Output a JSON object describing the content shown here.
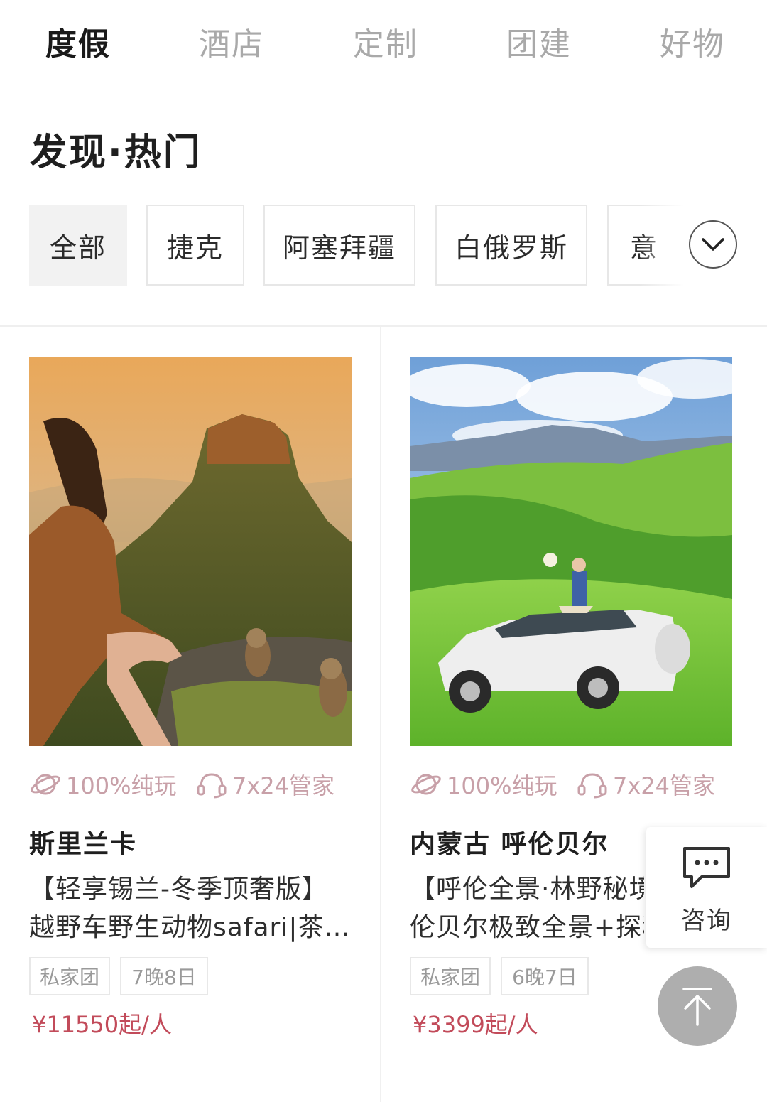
{
  "top_tabs": [
    {
      "label": "度假",
      "active": true
    },
    {
      "label": "酒店",
      "active": false
    },
    {
      "label": "定制",
      "active": false
    },
    {
      "label": "团建",
      "active": false
    },
    {
      "label": "好物",
      "active": false
    }
  ],
  "section": {
    "title": "发现·热门"
  },
  "filters": [
    {
      "label": "全部",
      "active": true
    },
    {
      "label": "捷克",
      "active": false
    },
    {
      "label": "阿塞拜疆",
      "active": false
    },
    {
      "label": "白俄罗斯",
      "active": false
    },
    {
      "label": "意",
      "active": false
    }
  ],
  "expand_icon": "chevron-down-icon",
  "cards": [
    {
      "photo_icon": "photo-sri-lanka-sigiriya",
      "features": [
        {
          "icon": "planet-icon",
          "label": "100%纯玩"
        },
        {
          "icon": "headset-icon",
          "label": "7x24管家"
        }
      ],
      "destination": "斯里兰卡",
      "desc_line1": "【轻享锡兰-冬季顶奢版】",
      "desc_line2": "越野车野生动物safari|茶…",
      "tags": [
        "私家团",
        "7晚8日"
      ],
      "price": "¥11550起/人"
    },
    {
      "photo_icon": "photo-inner-mongolia-grassland",
      "features": [
        {
          "icon": "planet-icon",
          "label": "100%纯玩"
        },
        {
          "icon": "headset-icon",
          "label": "7x24管家"
        }
      ],
      "destination": "内蒙古 呼伦贝尔",
      "desc_line1": "【呼伦全景·林野秘境",
      "desc_line2": "伦贝尔极致全景+探秘",
      "tags": [
        "私家团",
        "6晚7日"
      ],
      "price": "¥3399起/人"
    }
  ],
  "consult": {
    "label": "咨询",
    "icon": "chat-bubble-icon"
  },
  "back_to_top": {
    "icon": "arrow-up-icon"
  },
  "colors": {
    "accent_price": "#c24b5a",
    "feature_pink": "#c8a0a8",
    "inactive_tab": "#a9a9a9"
  }
}
